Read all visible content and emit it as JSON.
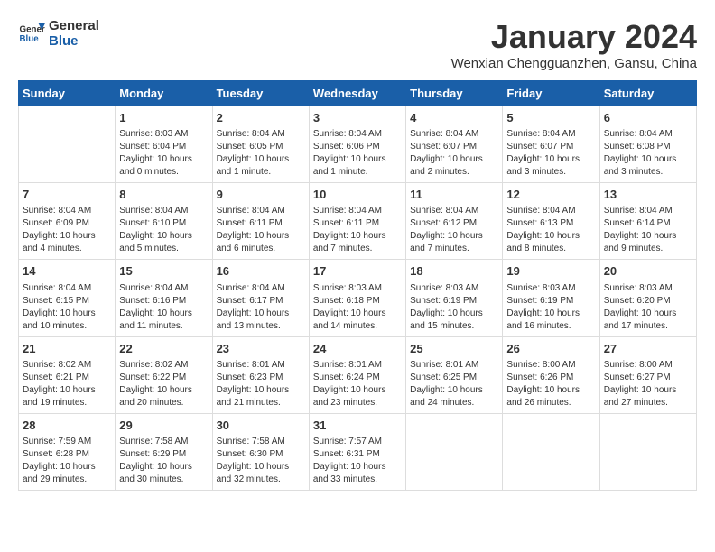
{
  "header": {
    "logo_line1": "General",
    "logo_line2": "Blue",
    "month": "January 2024",
    "location": "Wenxian Chengguanzhen, Gansu, China"
  },
  "weekdays": [
    "Sunday",
    "Monday",
    "Tuesday",
    "Wednesday",
    "Thursday",
    "Friday",
    "Saturday"
  ],
  "weeks": [
    [
      {
        "day": "",
        "info": ""
      },
      {
        "day": "1",
        "info": "Sunrise: 8:03 AM\nSunset: 6:04 PM\nDaylight: 10 hours\nand 0 minutes."
      },
      {
        "day": "2",
        "info": "Sunrise: 8:04 AM\nSunset: 6:05 PM\nDaylight: 10 hours\nand 1 minute."
      },
      {
        "day": "3",
        "info": "Sunrise: 8:04 AM\nSunset: 6:06 PM\nDaylight: 10 hours\nand 1 minute."
      },
      {
        "day": "4",
        "info": "Sunrise: 8:04 AM\nSunset: 6:07 PM\nDaylight: 10 hours\nand 2 minutes."
      },
      {
        "day": "5",
        "info": "Sunrise: 8:04 AM\nSunset: 6:07 PM\nDaylight: 10 hours\nand 3 minutes."
      },
      {
        "day": "6",
        "info": "Sunrise: 8:04 AM\nSunset: 6:08 PM\nDaylight: 10 hours\nand 3 minutes."
      }
    ],
    [
      {
        "day": "7",
        "info": "Sunrise: 8:04 AM\nSunset: 6:09 PM\nDaylight: 10 hours\nand 4 minutes."
      },
      {
        "day": "8",
        "info": "Sunrise: 8:04 AM\nSunset: 6:10 PM\nDaylight: 10 hours\nand 5 minutes."
      },
      {
        "day": "9",
        "info": "Sunrise: 8:04 AM\nSunset: 6:11 PM\nDaylight: 10 hours\nand 6 minutes."
      },
      {
        "day": "10",
        "info": "Sunrise: 8:04 AM\nSunset: 6:11 PM\nDaylight: 10 hours\nand 7 minutes."
      },
      {
        "day": "11",
        "info": "Sunrise: 8:04 AM\nSunset: 6:12 PM\nDaylight: 10 hours\nand 7 minutes."
      },
      {
        "day": "12",
        "info": "Sunrise: 8:04 AM\nSunset: 6:13 PM\nDaylight: 10 hours\nand 8 minutes."
      },
      {
        "day": "13",
        "info": "Sunrise: 8:04 AM\nSunset: 6:14 PM\nDaylight: 10 hours\nand 9 minutes."
      }
    ],
    [
      {
        "day": "14",
        "info": "Sunrise: 8:04 AM\nSunset: 6:15 PM\nDaylight: 10 hours\nand 10 minutes."
      },
      {
        "day": "15",
        "info": "Sunrise: 8:04 AM\nSunset: 6:16 PM\nDaylight: 10 hours\nand 11 minutes."
      },
      {
        "day": "16",
        "info": "Sunrise: 8:04 AM\nSunset: 6:17 PM\nDaylight: 10 hours\nand 13 minutes."
      },
      {
        "day": "17",
        "info": "Sunrise: 8:03 AM\nSunset: 6:18 PM\nDaylight: 10 hours\nand 14 minutes."
      },
      {
        "day": "18",
        "info": "Sunrise: 8:03 AM\nSunset: 6:19 PM\nDaylight: 10 hours\nand 15 minutes."
      },
      {
        "day": "19",
        "info": "Sunrise: 8:03 AM\nSunset: 6:19 PM\nDaylight: 10 hours\nand 16 minutes."
      },
      {
        "day": "20",
        "info": "Sunrise: 8:03 AM\nSunset: 6:20 PM\nDaylight: 10 hours\nand 17 minutes."
      }
    ],
    [
      {
        "day": "21",
        "info": "Sunrise: 8:02 AM\nSunset: 6:21 PM\nDaylight: 10 hours\nand 19 minutes."
      },
      {
        "day": "22",
        "info": "Sunrise: 8:02 AM\nSunset: 6:22 PM\nDaylight: 10 hours\nand 20 minutes."
      },
      {
        "day": "23",
        "info": "Sunrise: 8:01 AM\nSunset: 6:23 PM\nDaylight: 10 hours\nand 21 minutes."
      },
      {
        "day": "24",
        "info": "Sunrise: 8:01 AM\nSunset: 6:24 PM\nDaylight: 10 hours\nand 23 minutes."
      },
      {
        "day": "25",
        "info": "Sunrise: 8:01 AM\nSunset: 6:25 PM\nDaylight: 10 hours\nand 24 minutes."
      },
      {
        "day": "26",
        "info": "Sunrise: 8:00 AM\nSunset: 6:26 PM\nDaylight: 10 hours\nand 26 minutes."
      },
      {
        "day": "27",
        "info": "Sunrise: 8:00 AM\nSunset: 6:27 PM\nDaylight: 10 hours\nand 27 minutes."
      }
    ],
    [
      {
        "day": "28",
        "info": "Sunrise: 7:59 AM\nSunset: 6:28 PM\nDaylight: 10 hours\nand 29 minutes."
      },
      {
        "day": "29",
        "info": "Sunrise: 7:58 AM\nSunset: 6:29 PM\nDaylight: 10 hours\nand 30 minutes."
      },
      {
        "day": "30",
        "info": "Sunrise: 7:58 AM\nSunset: 6:30 PM\nDaylight: 10 hours\nand 32 minutes."
      },
      {
        "day": "31",
        "info": "Sunrise: 7:57 AM\nSunset: 6:31 PM\nDaylight: 10 hours\nand 33 minutes."
      },
      {
        "day": "",
        "info": ""
      },
      {
        "day": "",
        "info": ""
      },
      {
        "day": "",
        "info": ""
      }
    ]
  ]
}
